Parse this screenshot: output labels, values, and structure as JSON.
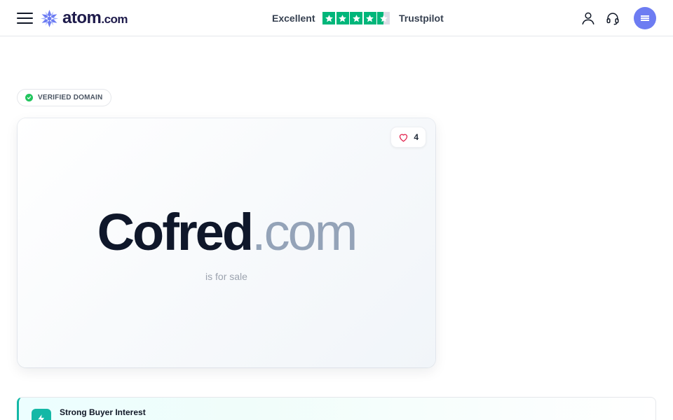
{
  "header": {
    "logo_name": "atom",
    "logo_tld": ".com",
    "trust_label": "Excellent",
    "trust_brand": "Trustpilot",
    "trust_stars": 4.5,
    "accent_color": "#6d7cf2",
    "trust_color": "#00b67a"
  },
  "badge": {
    "label": "VERIFIED DOMAIN"
  },
  "domain": {
    "name": "Cofred",
    "extension": ".com",
    "status": "is for sale",
    "likes": "4"
  },
  "interest": {
    "title": "Strong Buyer Interest"
  }
}
